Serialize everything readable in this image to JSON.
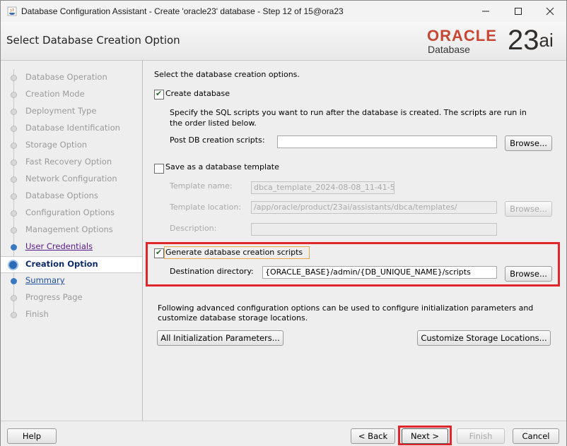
{
  "window": {
    "title": "Database Configuration Assistant - Create 'oracle23' database - Step 12 of 15@ora23"
  },
  "header": {
    "page_title": "Select Database Creation Option",
    "logo_brand": "ORACLE",
    "logo_product": "Database",
    "logo_version": "23",
    "logo_suffix": "ai"
  },
  "steps": [
    {
      "label": "Database Operation",
      "state": "disabled"
    },
    {
      "label": "Creation Mode",
      "state": "disabled"
    },
    {
      "label": "Deployment Type",
      "state": "disabled"
    },
    {
      "label": "Database Identification",
      "state": "disabled"
    },
    {
      "label": "Storage Option",
      "state": "disabled"
    },
    {
      "label": "Fast Recovery Option",
      "state": "disabled"
    },
    {
      "label": "Network Configuration",
      "state": "disabled"
    },
    {
      "label": "Database Options",
      "state": "disabled"
    },
    {
      "label": "Configuration Options",
      "state": "disabled"
    },
    {
      "label": "Management Options",
      "state": "disabled"
    },
    {
      "label": "User Credentials",
      "state": "done"
    },
    {
      "label": "Creation Option",
      "state": "current"
    },
    {
      "label": "Summary",
      "state": "next"
    },
    {
      "label": "Progress Page",
      "state": "disabled"
    },
    {
      "label": "Finish",
      "state": "disabled"
    }
  ],
  "content": {
    "intro": "Select the database creation options.",
    "create_db": {
      "label": "Create database",
      "checked": true,
      "desc_line1": "Specify the SQL scripts you want to run after the database is created. The scripts are run in",
      "desc_line2": "the order listed below.",
      "post_label": "Post DB creation scripts:",
      "post_value": "",
      "browse": "Browse..."
    },
    "template": {
      "label": "Save as a database template",
      "checked": false,
      "name_label": "Template name:",
      "name_value": "dbca_template_2024-08-08_11-41-5",
      "location_label": "Template location:",
      "location_value": "/app/oracle/product/23ai/assistants/dbca/templates/",
      "desc_label": "Description:",
      "desc_value": "",
      "browse": "Browse..."
    },
    "scripts": {
      "label": "Generate database creation scripts",
      "checked": true,
      "dest_label": "Destination directory:",
      "dest_value": "{ORACLE_BASE}/admin/{DB_UNIQUE_NAME}/scripts",
      "browse": "Browse..."
    },
    "advanced_line1": "Following advanced configuration options can be used to configure initialization parameters and",
    "advanced_line2": "customize database storage locations.",
    "init_params_button": "All Initialization Parameters...",
    "storage_button": "Customize Storage Locations..."
  },
  "footer": {
    "help": "Help",
    "back": "< Back",
    "next": "Next >",
    "finish": "Finish",
    "cancel": "Cancel"
  },
  "colors": {
    "highlight": "#e0262b",
    "oracle_red": "#c74634",
    "current_step": "#0d2b6b"
  }
}
